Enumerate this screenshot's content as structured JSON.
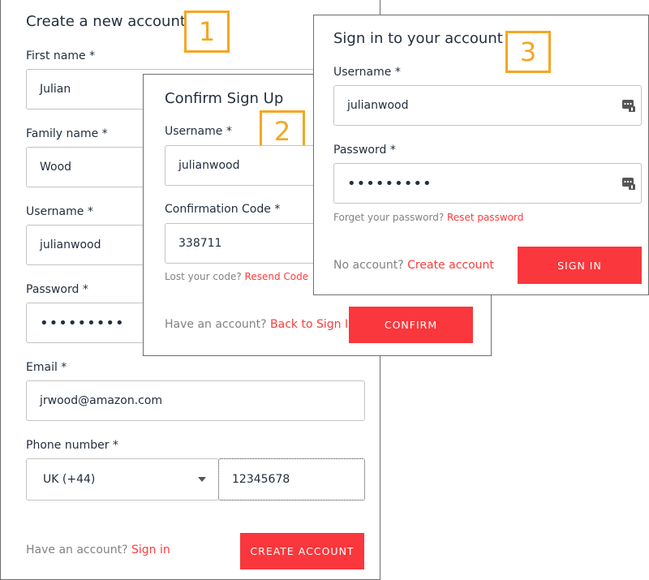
{
  "signup": {
    "title": "Create a new account",
    "badge": "1",
    "first_name_label": "First name *",
    "first_name_value": "Julian",
    "family_name_label": "Family name *",
    "family_name_value": "Wood",
    "username_label": "Username *",
    "username_value": "julianwood",
    "password_label": "Password *",
    "password_value": "•••••••••",
    "email_label": "Email *",
    "email_value": "jrwood@amazon.com",
    "phone_label": "Phone number *",
    "country_code": "UK (+44)",
    "phone_value": "12345678",
    "have_account": "Have an account?",
    "sign_in_link": "Sign in",
    "create_button": "CREATE ACCOUNT"
  },
  "confirm": {
    "title": "Confirm Sign Up",
    "badge": "2",
    "username_label": "Username *",
    "username_value": "julianwood",
    "code_label": "Confirmation Code *",
    "code_value": "338711",
    "lost_code": "Lost your code?",
    "resend_link": "Resend Code",
    "have_account": "Have an account?",
    "back_link": "Back to Sign In",
    "confirm_button": "CONFIRM"
  },
  "signin": {
    "title": "Sign in to your account",
    "badge": "3",
    "username_label": "Username *",
    "username_value": "julianwood",
    "password_label": "Password *",
    "password_value": "•••••••••",
    "forgot": "Forget your password?",
    "reset_link": "Reset password",
    "no_account": "No account?",
    "create_link": "Create account",
    "signin_button": "SIGN IN"
  },
  "colors": {
    "accent": "#f9373c",
    "link": "#ff3b3b",
    "badge": "#f5a623"
  },
  "icons": {
    "password_manager": "keyboard-key-icon",
    "select_caret": "chevron-down-icon"
  }
}
